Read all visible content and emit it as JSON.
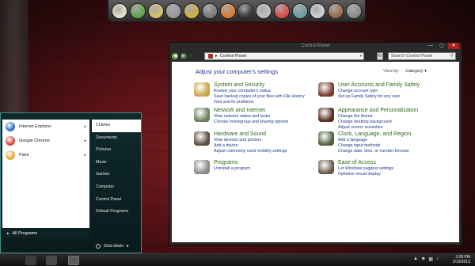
{
  "desktop": {
    "dock_icons": [
      "user-icon",
      "chrome-icon",
      "clock-icon",
      "robot-icon",
      "media-icon",
      "gallery-icon",
      "firefox-icon",
      "drive-icon",
      "flag-icon",
      "power-icon",
      "gear-icon",
      "display-icon",
      "video-icon",
      "folder-icon"
    ]
  },
  "control_panel": {
    "window_title": "Control Panel",
    "address": "Control Panel",
    "search_placeholder": "Search Control Panel",
    "heading": "Adjust your computer's settings",
    "view_by_label": "View by:",
    "view_by_value": "Category",
    "categories_left": [
      {
        "title": "System and Security",
        "links": [
          "Review your computer's status",
          "Save backup copies of your files with File History",
          "Find and fix problems"
        ],
        "color": "#c9a24b"
      },
      {
        "title": "Network and Internet",
        "links": [
          "View network status and tasks",
          "Choose homegroup and sharing options"
        ],
        "color": "#6d7f5a"
      },
      {
        "title": "Hardware and Sound",
        "links": [
          "View devices and printers",
          "Add a device",
          "Adjust commonly used mobility settings"
        ],
        "color": "#5a4a3e"
      },
      {
        "title": "Programs",
        "links": [
          "Uninstall a program"
        ],
        "color": "#8a8a8a"
      }
    ],
    "categories_right": [
      {
        "title": "User Accounts and Family Safety",
        "links": [
          "Change account type",
          "Set up Family Safety for any user"
        ],
        "color": "#7a3a2a"
      },
      {
        "title": "Appearance and Personalization",
        "links": [
          "Change the theme",
          "Change desktop background",
          "Adjust screen resolution"
        ],
        "color": "#5a2a20"
      },
      {
        "title": "Clock, Language, and Region",
        "links": [
          "Add a language",
          "Change input methods",
          "Change date, time, or number formats"
        ],
        "color": "#4f5f3a"
      },
      {
        "title": "Ease of Access",
        "links": [
          "Let Windows suggest settings",
          "Optimize visual display"
        ],
        "color": "#6a5a48"
      }
    ]
  },
  "start_menu": {
    "programs": [
      {
        "label": "Internet Explorer",
        "color": "#2d6ec9"
      },
      {
        "label": "Google Chrome",
        "color": "#d9443a"
      },
      {
        "label": "Paint",
        "color": "#e0a93a"
      }
    ],
    "all_programs": "All Programs",
    "right_items": [
      "Charles",
      "Documents",
      "Pictures",
      "Music",
      "Games",
      "Computer",
      "Control Panel",
      "Default Programs"
    ],
    "shutdown": "Shut down"
  },
  "taskbar": {
    "time": "2:08 PM",
    "date": "2/19/2013"
  }
}
